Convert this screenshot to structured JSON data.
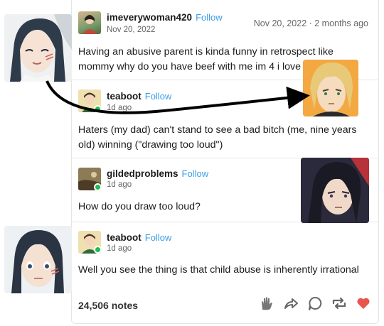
{
  "posts": [
    {
      "username": "imeverywoman420",
      "follow": "Follow",
      "date": "Nov 20, 2022",
      "meta": "Nov 20, 2022 · 2 months ago",
      "text": "Having an abusive parent is kinda funny in retrospect like mommy why do you have beef with me im 4 i love you"
    },
    {
      "username": "teaboot",
      "follow": "Follow",
      "date": "1d ago",
      "text": "Haters (my dad) can't stand to see a bad bitch (me, nine years old) winning (\"drawing too loud\")"
    },
    {
      "username": "gildedproblems",
      "follow": "Follow",
      "date": "1d ago",
      "text": "How do you draw too loud?"
    },
    {
      "username": "teaboot",
      "follow": "Follow",
      "date": "1d ago",
      "text": "Well you see the thing is that child abuse is inherently irrational"
    }
  ],
  "footer": {
    "notes": "24,506 notes"
  },
  "icons": [
    "clap-icon",
    "share-icon",
    "reply-icon",
    "reblog-icon",
    "heart-icon"
  ],
  "colors": {
    "follow": "#3b9ee8",
    "heart": "#e8554e",
    "online_badge": "#1dbd4e"
  }
}
